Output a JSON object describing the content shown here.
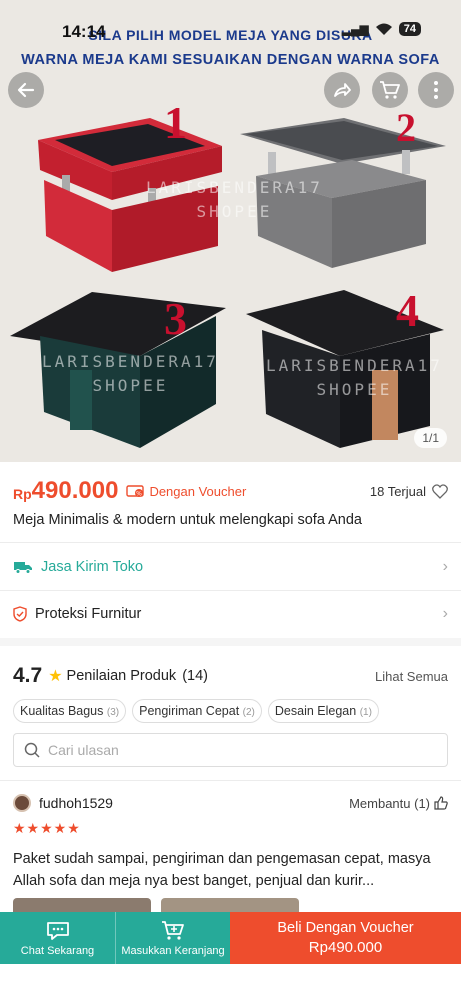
{
  "status": {
    "time": "14:14",
    "battery": "74"
  },
  "banner": {
    "line1": "SILA PILIH MODEL MEJA YANG DISUKA",
    "line2": "WARNA MEJA KAMI SESUAIKAN DENGAN WARNA SOFA"
  },
  "image": {
    "numbers": [
      "1",
      "2",
      "3",
      "4"
    ],
    "watermark_line1": "LARISBENDERA17",
    "watermark_line2": "SHOPEE",
    "counter": "1/1"
  },
  "price": {
    "prefix": "Rp",
    "value": "490.000",
    "voucher_text": "Dengan Voucher",
    "sold": "18 Terjual"
  },
  "product_title": "Meja Minimalis & modern untuk melengkapi sofa Anda",
  "shipping_label": "Jasa Kirim Toko",
  "protection_label": "Proteksi Furnitur",
  "rating": {
    "score": "4.7",
    "title": "Penilaian Produk",
    "count": "(14)",
    "see_all": "Lihat Semua",
    "chips": [
      {
        "label": "Kualitas Bagus",
        "count": "(3)"
      },
      {
        "label": "Pengiriman Cepat",
        "count": "(2)"
      },
      {
        "label": "Desain Elegan",
        "count": "(1)"
      }
    ],
    "search_placeholder": "Cari ulasan"
  },
  "review": {
    "username": "fudhoh1529",
    "helpful": "Membantu (1)",
    "stars": "★★★★★",
    "text": "Paket sudah sampai, pengiriman dan pengemasan cepat, masya Allah sofa dan meja nya best banget, penjual dan kurir..."
  },
  "bottom": {
    "chat": "Chat Sekarang",
    "cart": "Masukkan Keranjang",
    "buy_line1": "Beli Dengan Voucher",
    "buy_line2": "Rp490.000"
  },
  "colors": {
    "accent": "#ee4d2d",
    "teal": "#26aa99",
    "banner_text": "#1b3a8c",
    "number_red": "#c8102e"
  }
}
